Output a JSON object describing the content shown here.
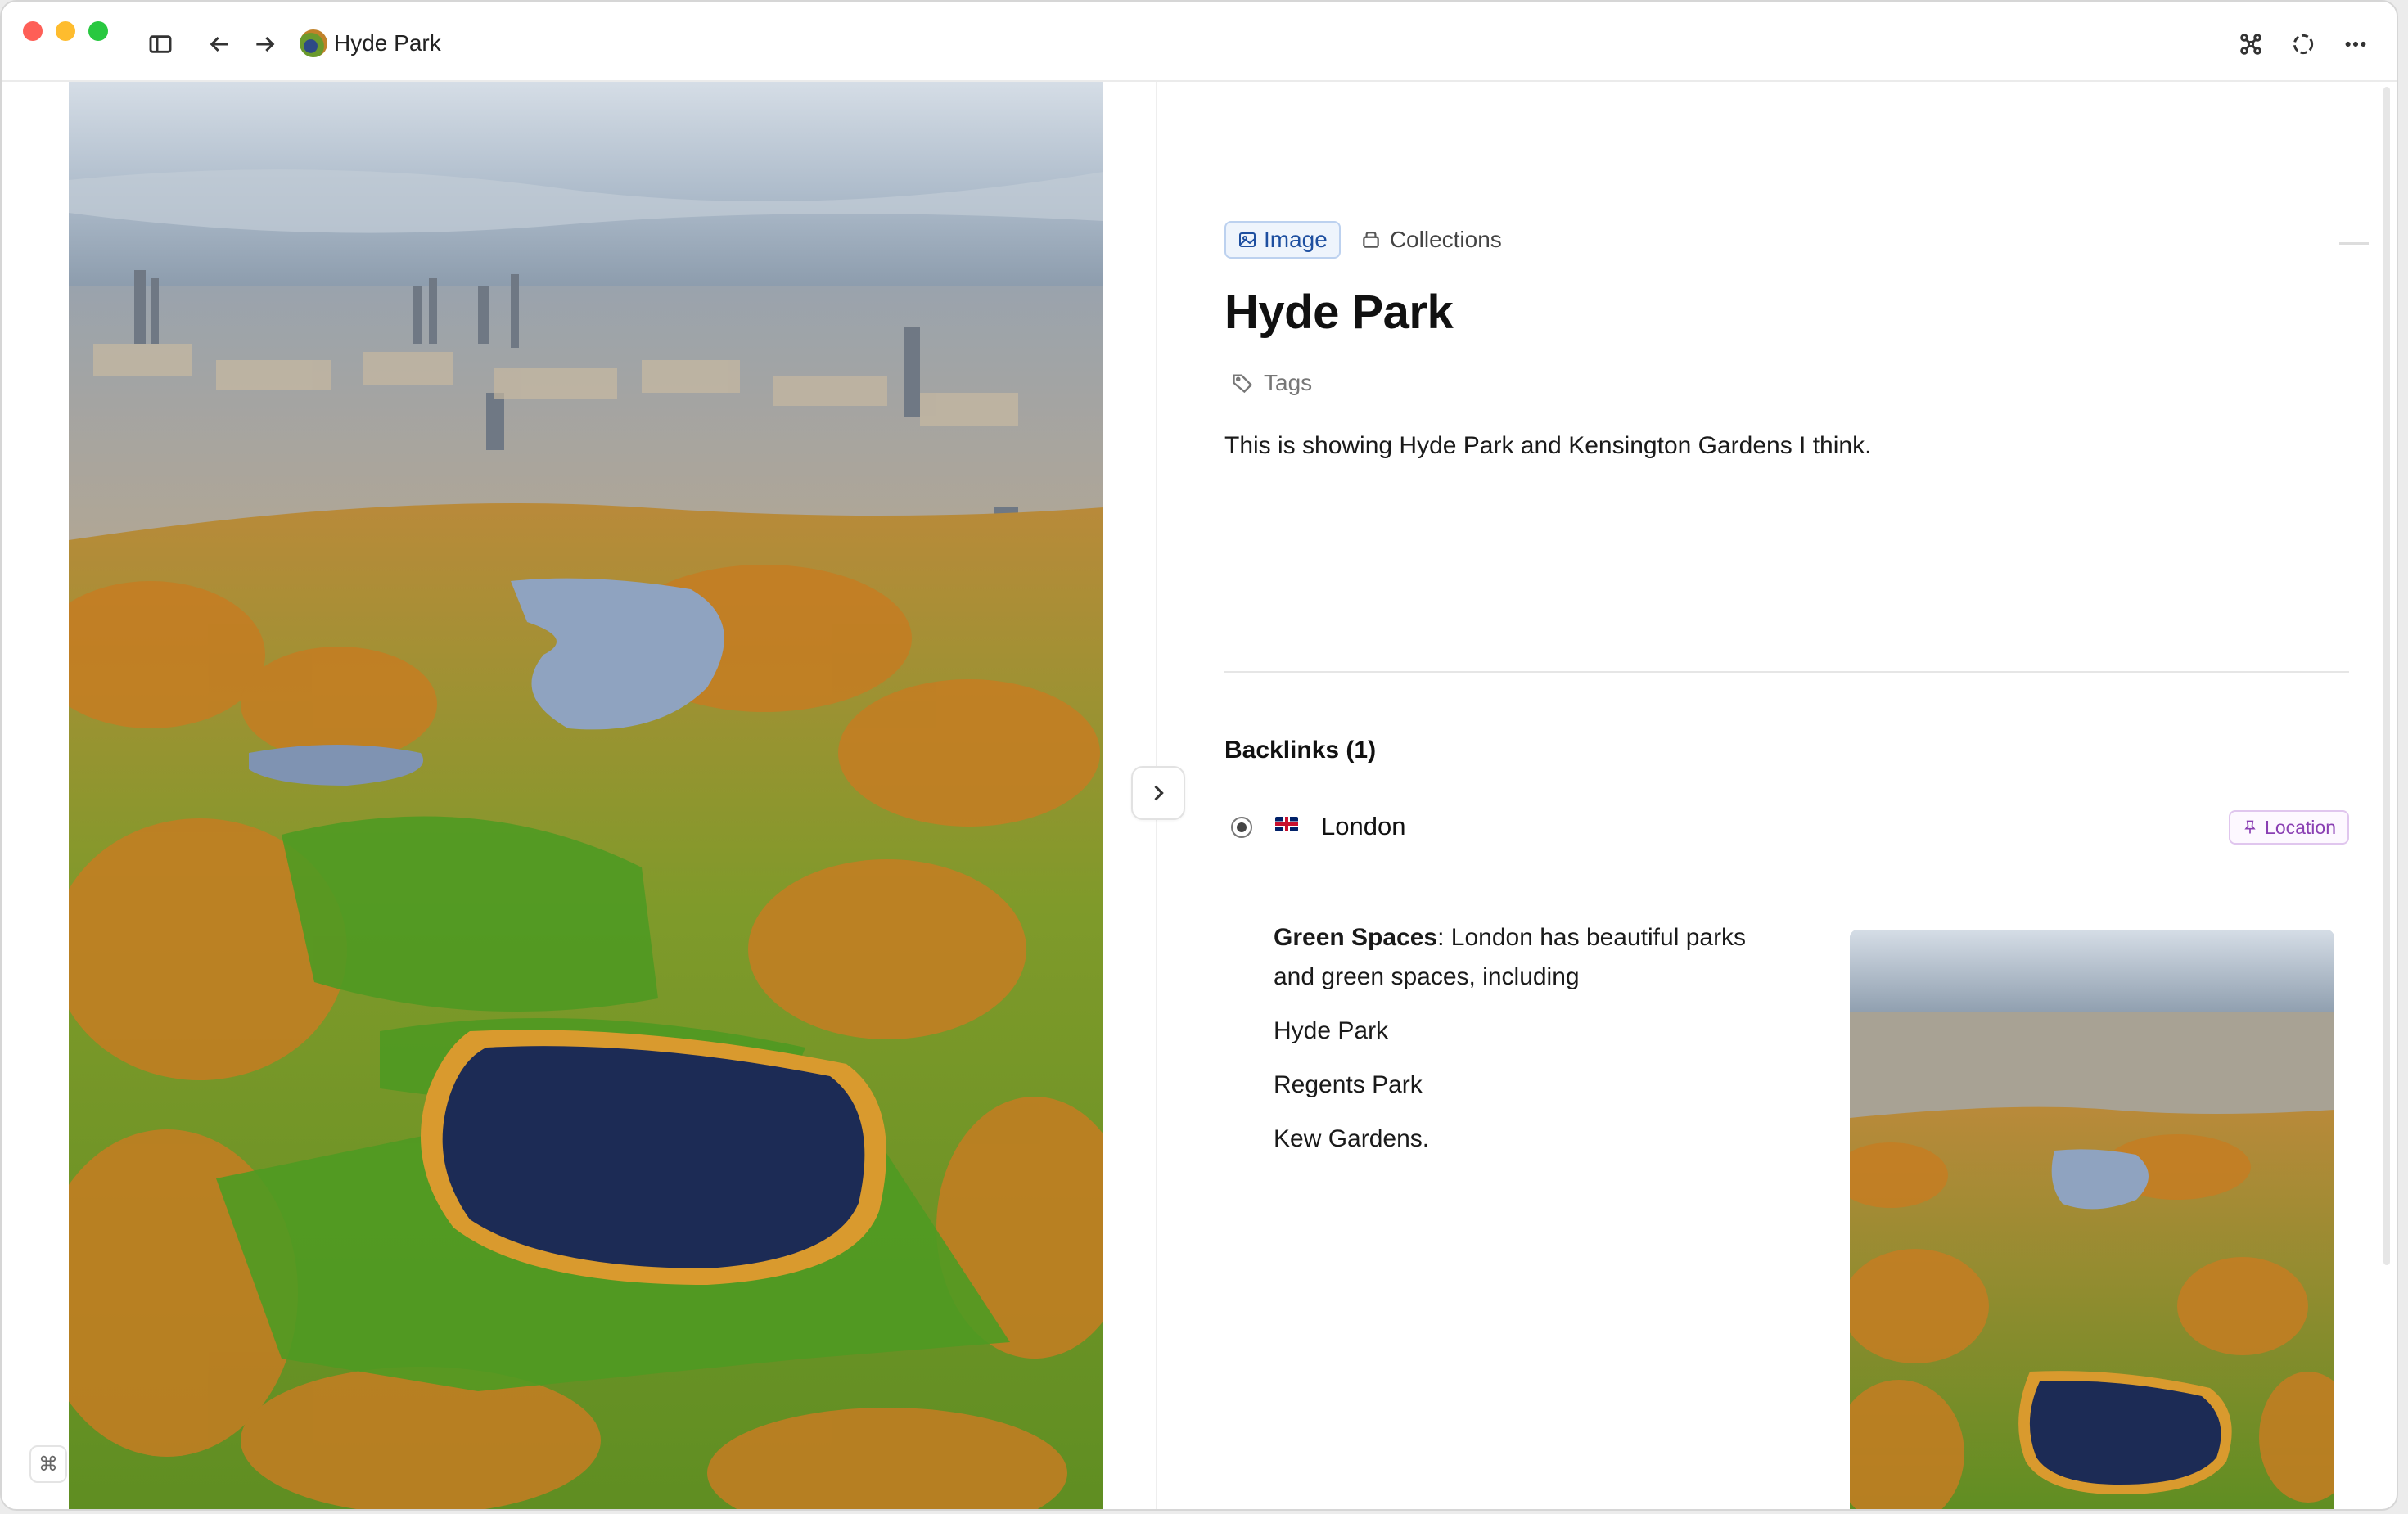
{
  "titlebar": {
    "breadcrumb": "Hyde Park",
    "icons": [
      "sidebar-toggle-icon",
      "back-arrow-icon",
      "forward-arrow-icon",
      "graph-icon",
      "sync-icon",
      "more-icon"
    ]
  },
  "page": {
    "type_label": "Image",
    "collections_label": "Collections",
    "title": "Hyde Park",
    "tags_label": "Tags",
    "description": "This is showing Hyde Park and Kensington Gardens I think."
  },
  "backlinks": {
    "title": "Backlinks (1)",
    "items": [
      {
        "name": "London",
        "badge": "Location",
        "snippet_bold": "Green Spaces",
        "snippet_rest": ": London has beautiful parks and green spaces, including",
        "list": [
          "Hyde Park",
          "Regents Park",
          "Kew Gardens."
        ]
      }
    ]
  },
  "footer": {
    "command_key": "⌘"
  },
  "colors": {
    "image_chip": "#1e4fa0",
    "location_badge": "#8a3fb3",
    "traffic_red": "#fe5f57",
    "traffic_yellow": "#febc2e",
    "traffic_green": "#28c840"
  }
}
